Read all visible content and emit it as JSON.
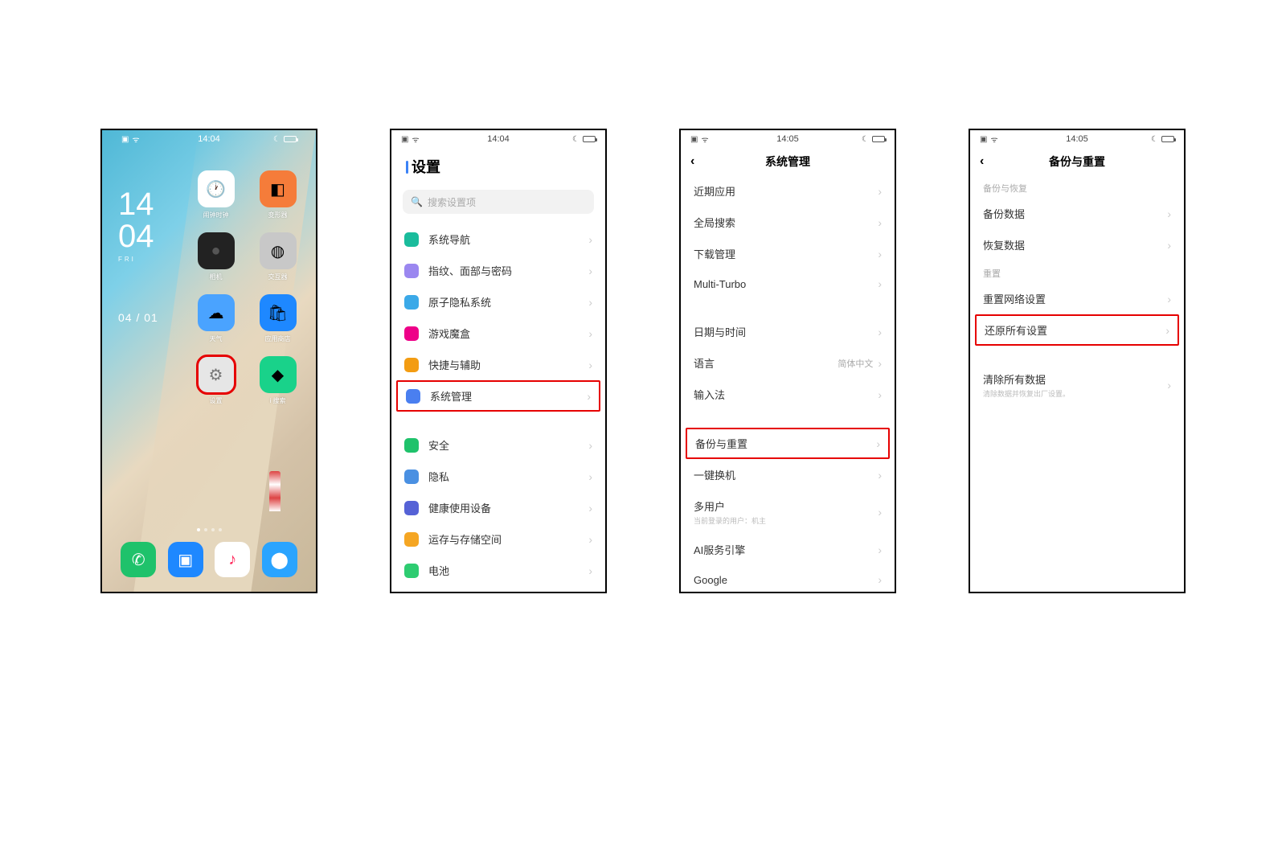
{
  "screen1": {
    "statusbar": {
      "time": "14:04"
    },
    "clock": {
      "hh": "14",
      "mm": "04",
      "day": "FRI"
    },
    "date": "04 / 01",
    "apps": [
      {
        "id": "app-clock",
        "label": "闹钟时钟",
        "bg": "#fff"
      },
      {
        "id": "app-cube",
        "label": "变形器",
        "bg": "#f57c3a"
      },
      {
        "id": "app-camera",
        "label": "相机",
        "bg": "#222"
      },
      {
        "id": "app-box",
        "label": "交互器",
        "bg": "#c8c8c8"
      },
      {
        "id": "app-weather",
        "label": "天气",
        "bg": "#4aa3ff"
      },
      {
        "id": "app-store",
        "label": "应用商店",
        "bg": "#1e88ff"
      },
      {
        "id": "app-settings",
        "label": "设置",
        "bg": "#e6e6e6",
        "highlight": true
      },
      {
        "id": "app-search",
        "label": "i 搜索",
        "bg": "#19d28a"
      }
    ],
    "dock": [
      {
        "id": "dock-phone",
        "bg": "#1fc26b"
      },
      {
        "id": "dock-mail",
        "bg": "#1e88ff"
      },
      {
        "id": "dock-music",
        "bg": "#fff"
      },
      {
        "id": "dock-browser",
        "bg": "#2aa4ff"
      }
    ]
  },
  "screen2": {
    "statusbar": {
      "time": "14:04"
    },
    "title": "设置",
    "search_placeholder": "搜索设置项",
    "groups": [
      {
        "rows": [
          {
            "id": "row-sysnav",
            "icon": "ic-teal",
            "label": "系统导航"
          },
          {
            "id": "row-fingerprint",
            "icon": "ic-purple",
            "label": "指纹、面部与密码"
          },
          {
            "id": "row-atom",
            "icon": "ic-blue",
            "label": "原子隐私系统"
          },
          {
            "id": "row-gamebox",
            "icon": "ic-pink",
            "label": "游戏魔盒"
          },
          {
            "id": "row-shortcut",
            "icon": "ic-orange",
            "label": "快捷与辅助"
          },
          {
            "id": "row-sysmgmt",
            "icon": "ic-bluehex",
            "label": "系统管理",
            "highlight": true
          }
        ]
      },
      {
        "rows": [
          {
            "id": "row-security",
            "icon": "ic-green",
            "label": "安全"
          },
          {
            "id": "row-privacy",
            "icon": "ic-lock",
            "label": "隐私"
          },
          {
            "id": "row-health",
            "icon": "ic-health",
            "label": "健康使用设备"
          },
          {
            "id": "row-storage",
            "icon": "ic-storage",
            "label": "运存与存储空间"
          },
          {
            "id": "row-battery",
            "icon": "ic-batt",
            "label": "电池"
          }
        ]
      }
    ]
  },
  "screen3": {
    "statusbar": {
      "time": "14:05"
    },
    "title": "系统管理",
    "groups": [
      {
        "rows": [
          {
            "id": "row-recent",
            "label": "近期应用"
          },
          {
            "id": "row-search",
            "label": "全局搜索"
          },
          {
            "id": "row-download",
            "label": "下载管理"
          },
          {
            "id": "row-multiturbo",
            "label": "Multi-Turbo"
          }
        ]
      },
      {
        "rows": [
          {
            "id": "row-datetime",
            "label": "日期与时间"
          },
          {
            "id": "row-language",
            "label": "语言",
            "value": "简体中文"
          },
          {
            "id": "row-input",
            "label": "输入法"
          }
        ]
      },
      {
        "rows": [
          {
            "id": "row-backup-reset",
            "label": "备份与重置",
            "highlight": true
          },
          {
            "id": "row-easyswap",
            "label": "一键换机"
          },
          {
            "id": "row-multiuser",
            "label": "多用户",
            "sub": "当前登录的用户：机主"
          },
          {
            "id": "row-ai",
            "label": "AI服务引擎"
          },
          {
            "id": "row-google",
            "label": "Google"
          }
        ]
      }
    ]
  },
  "screen4": {
    "statusbar": {
      "time": "14:05"
    },
    "title": "备份与重置",
    "groups": [
      {
        "section_label": "备份与恢复",
        "rows": [
          {
            "id": "row-backup-data",
            "label": "备份数据"
          },
          {
            "id": "row-restore-data",
            "label": "恢复数据"
          }
        ]
      },
      {
        "section_label": "重置",
        "rows": [
          {
            "id": "row-reset-network",
            "label": "重置网络设置"
          },
          {
            "id": "row-reset-all",
            "label": "还原所有设置",
            "highlight": true
          }
        ]
      },
      {
        "rows": [
          {
            "id": "row-clear-all",
            "label": "清除所有数据",
            "sub": "清除数据并恢复出厂设置。"
          }
        ]
      }
    ]
  }
}
